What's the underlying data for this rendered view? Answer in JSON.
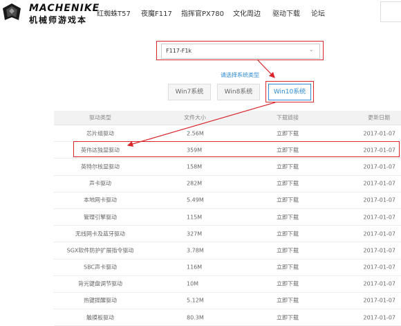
{
  "brand": {
    "name": "MACHENIKE",
    "sub": "机械师游戏本"
  },
  "nav": [
    "红蜘蛛T57",
    "夜魔F117",
    "指挥官PX780",
    "文化周边",
    "驱动下载",
    "论坛"
  ],
  "select": {
    "value": "F117-F1k"
  },
  "os_hint": "请选择系统类型",
  "os_buttons": [
    "Win7系统",
    "Win8系统",
    "Win10系统"
  ],
  "table": {
    "headers": [
      "驱动类型",
      "文件大小",
      "下载链接",
      "更新日期"
    ],
    "rows": [
      {
        "name": "芯片组驱动",
        "size": "2.56M",
        "link": "立即下载",
        "date": "2017-01-07"
      },
      {
        "name": "英伟达独显驱动",
        "size": "359M",
        "link": "立即下载",
        "date": "2017-01-07"
      },
      {
        "name": "英特尔核显驱动",
        "size": "158M",
        "link": "立即下载",
        "date": "2017-01-07"
      },
      {
        "name": "声卡驱动",
        "size": "282M",
        "link": "立即下载",
        "date": "2017-01-07"
      },
      {
        "name": "本地网卡驱动",
        "size": "5.49M",
        "link": "立即下载",
        "date": "2017-01-07"
      },
      {
        "name": "管理引擎驱动",
        "size": "115M",
        "link": "立即下载",
        "date": "2017-01-07"
      },
      {
        "name": "无线网卡及蓝牙驱动",
        "size": "327M",
        "link": "立即下载",
        "date": "2017-01-07"
      },
      {
        "name": "SGX软件防护扩展指令驱动",
        "size": "3.78M",
        "link": "立即下载",
        "date": "2017-01-07"
      },
      {
        "name": "SBC声卡驱动",
        "size": "116M",
        "link": "立即下载",
        "date": "2017-01-07"
      },
      {
        "name": "背光键盘调节驱动",
        "size": "10M",
        "link": "立即下载",
        "date": "2017-01-07"
      },
      {
        "name": "热键提醒驱动",
        "size": "5.12M",
        "link": "立即下载",
        "date": "2017-01-07"
      },
      {
        "name": "触摸板驱动",
        "size": "80.3M",
        "link": "立即下载",
        "date": "2017-01-07"
      }
    ]
  },
  "colors": {
    "accent": "#2e8ad6",
    "highlight": "#d9262b"
  }
}
